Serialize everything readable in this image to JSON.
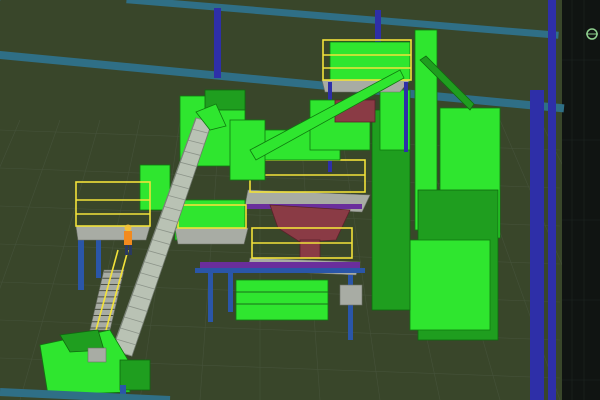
{
  "viewport": {
    "kind": "3D CAD plant model viewport",
    "colors": {
      "background": "#39462a",
      "floor_grid": "#4d5a44",
      "equipment": "#2fe62f",
      "equipment_dark": "#1f9e1f",
      "railing": "#f2e23a",
      "steel_blue": "#2a56a8",
      "steel_navy": "#2e2fa8",
      "steel_teal": "#2f6f86",
      "conveyor": "#b9c2b4",
      "grating": "#a8aca4",
      "hopper_red": "#8a3b45",
      "purple_beam": "#6a2e9c",
      "orange": "#f28a1e",
      "side_panel": "#101412"
    },
    "icons": [
      "operator-figure-icon",
      "cad-cursor-icon"
    ]
  }
}
